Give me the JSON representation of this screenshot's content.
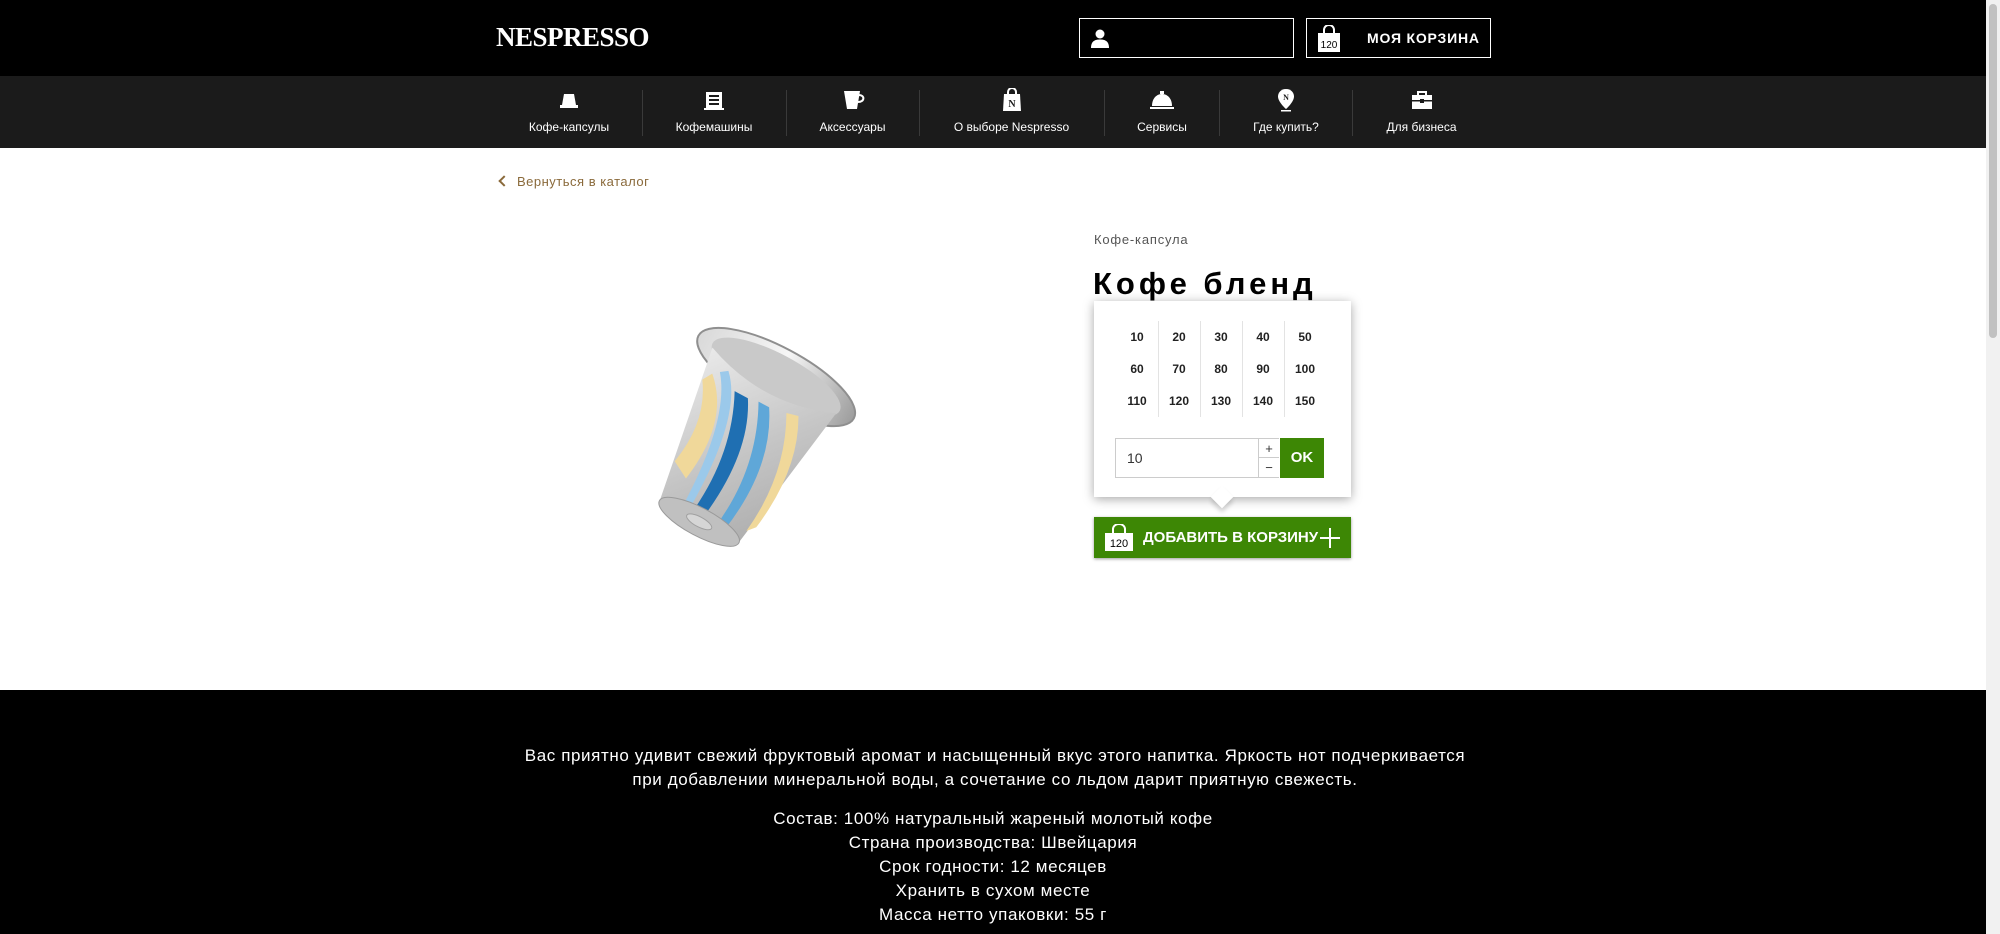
{
  "header": {
    "logo": "NESPRESSO",
    "cart_label": "МОЯ КОРЗИНА",
    "cart_count": "120"
  },
  "nav": {
    "items": [
      {
        "label": "Кофе-капсулы",
        "icon": "capsule-icon"
      },
      {
        "label": "Кофемашины",
        "icon": "coffee-machine-icon"
      },
      {
        "label": "Аксессуары",
        "icon": "cup-icon"
      },
      {
        "label": "О выборе Nespresso",
        "icon": "nespresso-bag-icon"
      },
      {
        "label": "Сервисы",
        "icon": "service-bell-icon"
      },
      {
        "label": "Где купить?",
        "icon": "location-pin-icon"
      },
      {
        "label": "Для бизнеса",
        "icon": "briefcase-icon"
      }
    ]
  },
  "back_link": "Вернуться в каталог",
  "product": {
    "category": "Кофе-капсула",
    "title": "Кофе бленд"
  },
  "qty_popup": {
    "options": [
      "10",
      "20",
      "30",
      "40",
      "50",
      "60",
      "70",
      "80",
      "90",
      "100",
      "110",
      "120",
      "130",
      "140",
      "150"
    ],
    "input_value": "10",
    "plus": "+",
    "minus": "−",
    "ok": "OK"
  },
  "add_to_cart": {
    "count": "120",
    "label": "ДОБАВИТЬ В КОРЗИНУ"
  },
  "description": {
    "text_line1": "Вас приятно удивит свежий фруктовый аромат и насыщенный вкус этого напитка. Яркость нот подчеркивается",
    "text_line2": "при добавлении минеральной воды, а сочетание со льдом дарит приятную свежесть.",
    "specs": [
      "Состав: 100% натуральный жареный молотый кофе",
      "Страна производства: Швейцария",
      "Срок годности: 12 месяцев",
      "Хранить в сухом месте",
      "Масса нетто упаковки: 55 г"
    ]
  },
  "colors": {
    "header_bg": "#000000",
    "nav_bg": "#1b1b1b",
    "accent_green": "#3d8705",
    "back_link": "#8a6a3b"
  }
}
